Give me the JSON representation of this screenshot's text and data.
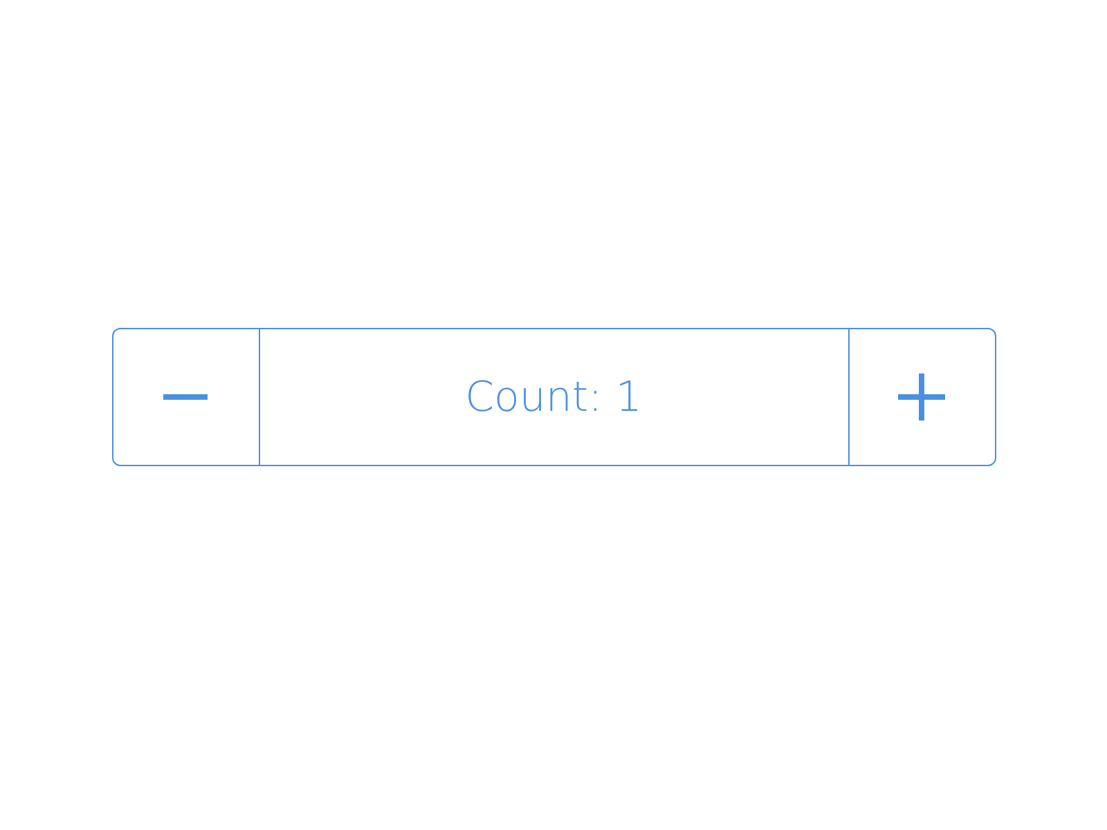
{
  "stepper": {
    "label": "Count: 1"
  }
}
